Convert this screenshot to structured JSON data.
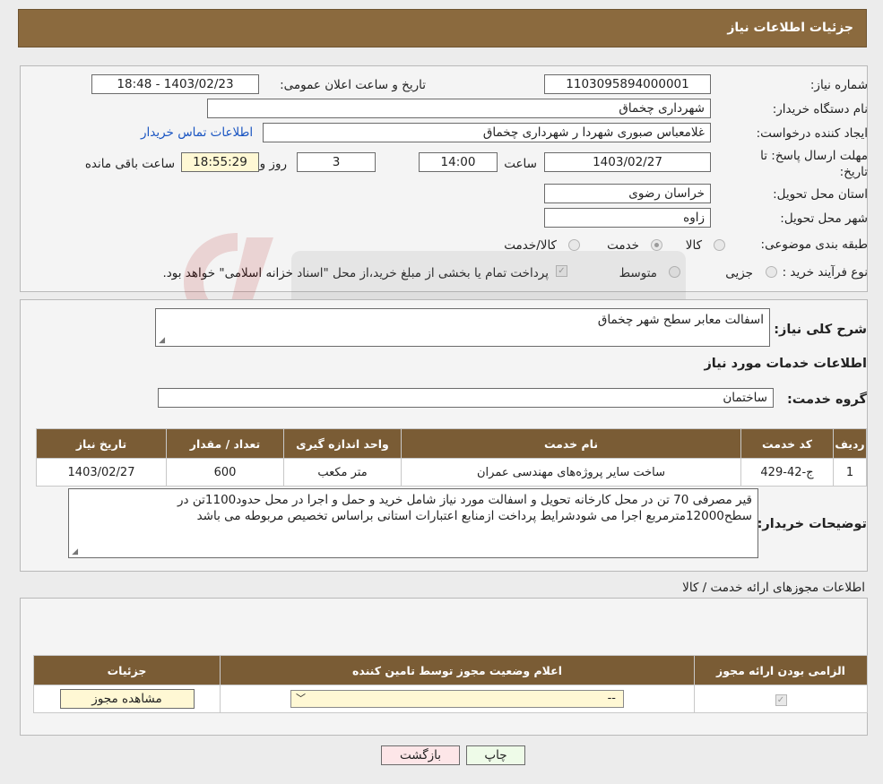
{
  "header": {
    "title": "جزئیات اطلاعات نیاز"
  },
  "form": {
    "need_number_label": "شماره نیاز:",
    "need_number": "1103095894000001",
    "announce_label": "تاریخ و ساعت اعلان عمومی:",
    "announce_value": "1403/02/23 - 18:48",
    "buyer_org_label": "نام دستگاه خریدار:",
    "buyer_org": "شهرداری چخماق",
    "creator_label": "ایجاد کننده درخواست:",
    "creator": "غلامعباس صبوری شهردا ر شهرداری چخماق",
    "contact_link": "اطلاعات تماس خریدار",
    "deadline_label": "مهلت ارسال پاسخ: تا تاریخ:",
    "deadline_date": "1403/02/27",
    "time_label": "ساعت",
    "deadline_time": "14:00",
    "days": "3",
    "days_label": "روز و",
    "remaining": "18:55:29",
    "remaining_label": "ساعت باقی مانده",
    "province_label": "استان محل تحویل:",
    "province": "خراسان رضوی",
    "city_label": "شهر محل تحویل:",
    "city": "زاوه",
    "category_label": "طبقه بندی موضوعی:",
    "category_options": [
      "کالا",
      "خدمت",
      "کالا/خدمت"
    ],
    "category_selected": "خدمت",
    "process_label": "نوع فرآیند خرید :",
    "process_options": [
      "جزیی",
      "متوسط"
    ],
    "process_note": "پرداخت تمام یا بخشی از مبلغ خرید،از محل \"اسناد خزانه اسلامی\" خواهد بود."
  },
  "details": {
    "summary_label": "شرح کلی نیاز:",
    "summary": "اسفالت معابر سطح شهر چخماق",
    "services_title": "اطلاعات خدمات مورد نیاز",
    "group_label": "گروه خدمت:",
    "group": "ساختمان",
    "table": {
      "headers": [
        "ردیف",
        "کد خدمت",
        "نام خدمت",
        "واحد اندازه گیری",
        "تعداد / مقدار",
        "تاریخ نیاز"
      ],
      "rows": [
        [
          "1",
          "ج-42-429",
          "ساخت سایر پروژه‌های مهندسی عمران",
          "متر مکعب",
          "600",
          "1403/02/27"
        ]
      ]
    },
    "buyer_notes_label": "توضیحات خریدار:",
    "buyer_notes": "قیر مصرفی 70 تن در محل کارخانه تحویل و اسفالت مورد نیاز شامل خرید و حمل و اجرا در محل حدود1100تن در سطح12000مترمربع اجرا می شودشرایط پرداخت  ازمنابع  اعتبارات استانی براساس تخصیص مربوطه می باشد"
  },
  "permits": {
    "title": "اطلاعات مجوزهای ارائه خدمت / کالا",
    "headers": [
      "الزامی بودن ارائه مجوز",
      "اعلام وضعیت مجوز توسط تامین کننده",
      "جزئیات"
    ],
    "select_value": "--",
    "view_button": "مشاهده مجوز"
  },
  "buttons": {
    "print": "چاپ",
    "back": "بازگشت"
  },
  "colors": {
    "header_bg": "#8b6a3e",
    "table_header_bg": "#7a5c35",
    "link": "#1a55c2",
    "yellow_field": "#fff8d4"
  }
}
